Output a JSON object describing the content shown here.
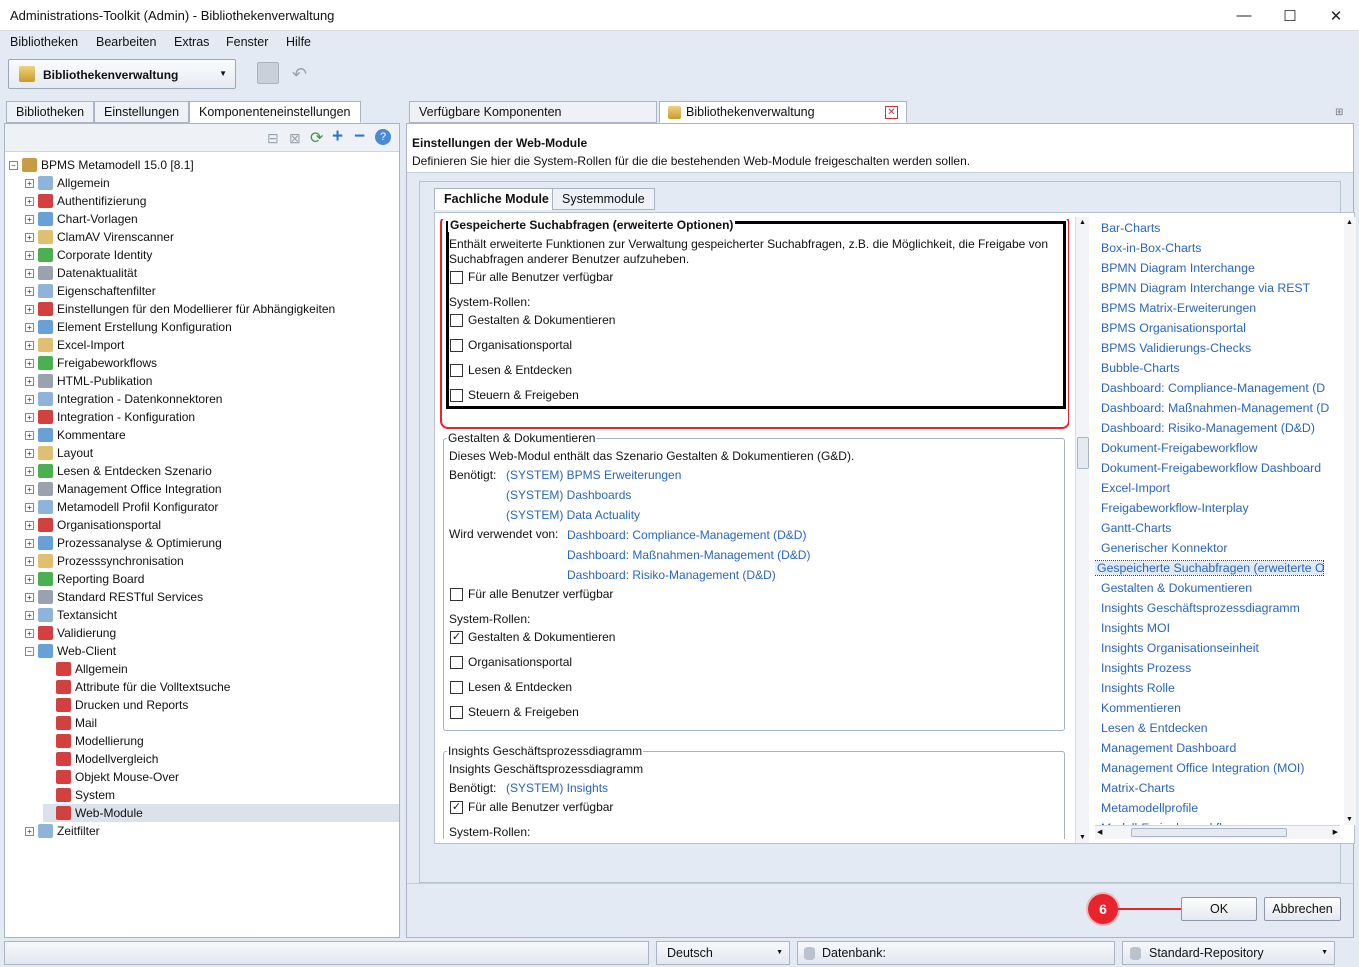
{
  "window": {
    "title": "Administrations-Toolkit (Admin) - Bibliothekenverwaltung",
    "minimize": "—",
    "maximize": "☐",
    "close": "✕"
  },
  "menu": [
    "Bibliotheken",
    "Bearbeiten",
    "Extras",
    "Fenster",
    "Hilfe"
  ],
  "toolbar": {
    "combo_label": "Bibliothekenverwaltung"
  },
  "left_tabs": [
    "Bibliotheken",
    "Einstellungen",
    "Komponenteneinstellungen"
  ],
  "right_tabs": [
    "Verfügbare Komponenten",
    "Bibliothekenverwaltung"
  ],
  "tree": {
    "root": "BPMS Metamodell 15.0 [8.1]",
    "items": [
      "Allgemein",
      "Authentifizierung",
      "Chart-Vorlagen",
      "ClamAV Virenscanner",
      "Corporate Identity",
      "Datenaktualität",
      "Eigenschaftenfilter",
      "Einstellungen für den Modellierer für Abhängigkeiten",
      "Element Erstellung Konfiguration",
      "Excel-Import",
      "Freigabeworkflows",
      "HTML-Publikation",
      "Integration - Datenkonnektoren",
      "Integration - Konfiguration",
      "Kommentare",
      "Layout",
      "Lesen & Entdecken Szenario",
      "Management Office Integration",
      "Metamodell Profil Konfigurator",
      "Organisationsportal",
      "Prozessanalyse & Optimierung",
      "Prozesssynchronisation",
      "Reporting Board",
      "Standard RESTful Services",
      "Textansicht",
      "Validierung",
      "Web-Client"
    ],
    "web_client_children": [
      "Allgemein",
      "Attribute für die Volltextsuche",
      "Drucken und Reports",
      "Mail",
      "Modellierung",
      "Modellvergleich",
      "Objekt Mouse-Over",
      "System",
      "Web-Module"
    ],
    "last": "Zeitfilter"
  },
  "header": {
    "title": "Einstellungen der Web-Module",
    "description": "Definieren Sie hier die System-Rollen für die die bestehenden Web-Module freigeschalten werden sollen."
  },
  "module_tabs": [
    "Fachliche Module",
    "Systemmodule"
  ],
  "section1": {
    "legend": "Gespeicherte Suchabfragen (erweiterte Optionen)",
    "desc1": "Enthält erweiterte Funktionen zur Verwaltung gespeicherter Suchabfragen, z.B. die Möglichkeit, die Freigabe von",
    "desc2": "Suchabfragen anderer Benutzer aufzuheben.",
    "all_users": "Für alle Benutzer verfügbar",
    "roles_label": "System-Rollen:",
    "roles": [
      "Gestalten & Dokumentieren",
      "Organisationsportal",
      "Lesen & Entdecken",
      "Steuern & Freigeben"
    ]
  },
  "section2": {
    "legend": "Gestalten & Dokumentieren",
    "desc": "Dieses Web-Modul enthält das Szenario Gestalten & Dokumentieren (G&D).",
    "requires_label": "Benötigt:",
    "requires": [
      "(SYSTEM) BPMS Erweiterungen",
      "(SYSTEM) Dashboards",
      "(SYSTEM) Data Actuality"
    ],
    "used_by_label": "Wird verwendet von:",
    "used_by": [
      "Dashboard: Compliance-Management (D&D)",
      "Dashboard: Maßnahmen-Management (D&D)",
      "Dashboard: Risiko-Management (D&D)"
    ],
    "all_users": "Für alle Benutzer verfügbar",
    "roles_label": "System-Rollen:",
    "roles": [
      "Gestalten & Dokumentieren",
      "Organisationsportal",
      "Lesen & Entdecken",
      "Steuern & Freigeben"
    ],
    "checked_role": "Gestalten & Dokumentieren"
  },
  "section3": {
    "legend": "Insights Geschäftsprozessdiagramm",
    "desc": "Insights Geschäftsprozessdiagramm",
    "requires_label": "Benötigt:",
    "requires": "(SYSTEM) Insights",
    "all_users": "Für alle Benutzer verfügbar",
    "roles_label": "System-Rollen:"
  },
  "nav_list": [
    "Bar-Charts",
    "Box-in-Box-Charts",
    "BPMN Diagram Interchange",
    "BPMN Diagram Interchange via REST",
    "BPMS Matrix-Erweiterungen",
    "BPMS Organisationsportal",
    "BPMS Validierungs-Checks",
    "Bubble-Charts",
    "Dashboard: Compliance-Management (D",
    "Dashboard: Maßnahmen-Management (D",
    "Dashboard: Risiko-Management (D&D)",
    "Dokument-Freigabeworkflow",
    "Dokument-Freigabeworkflow Dashboard",
    "Excel-Import",
    "Freigabeworkflow-Interplay",
    "Gantt-Charts",
    "Generischer Konnektor",
    "Gespeicherte Suchabfragen (erweiterte O",
    "Gestalten & Dokumentieren",
    "Insights Geschäftsprozessdiagramm",
    "Insights MOI",
    "Insights Organisationseinheit",
    "Insights Prozess",
    "Insights Rolle",
    "Kommentieren",
    "Lesen & Entdecken",
    "Management Dashboard",
    "Management Office Integration (MOI)",
    "Matrix-Charts",
    "Metamodellprofile",
    "Modell-Freigabeworkflow"
  ],
  "nav_selected": "Gespeicherte Suchabfragen (erweiterte O",
  "footer": {
    "badge": "6",
    "ok": "OK",
    "cancel": "Abbrechen"
  },
  "status": {
    "language": "Deutsch",
    "database": "Datenbank:",
    "repository": "Standard-Repository"
  },
  "colors": {
    "accent_red": "#e8232b",
    "link": "#2a66b9",
    "background": "#e3eaf3"
  }
}
